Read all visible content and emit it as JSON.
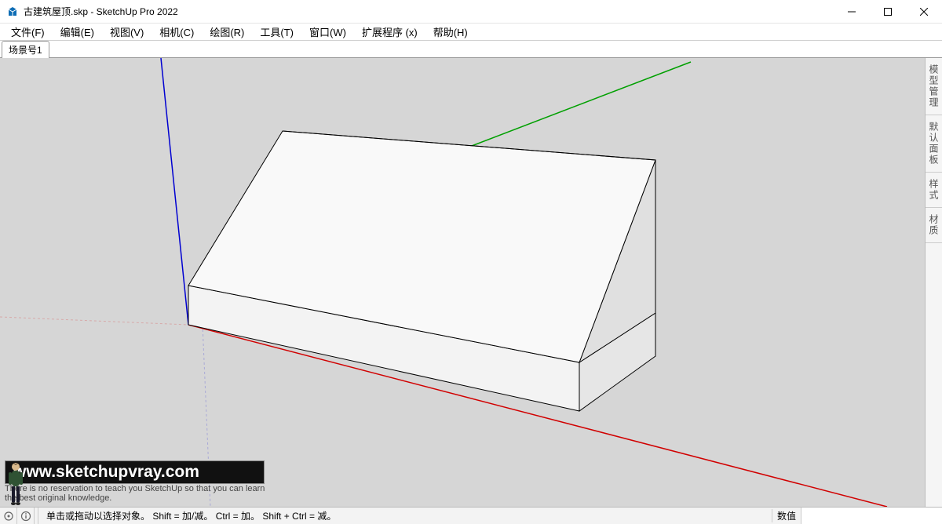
{
  "window": {
    "title": "古建筑屋顶.skp - SketchUp Pro 2022"
  },
  "menu": {
    "items": [
      "文件(F)",
      "编辑(E)",
      "视图(V)",
      "相机(C)",
      "绘图(R)",
      "工具(T)",
      "窗口(W)",
      "扩展程序 (x)",
      "帮助(H)"
    ]
  },
  "scenes": {
    "tabs": [
      "场景号1"
    ]
  },
  "tray": {
    "tabs": [
      "模型管理",
      "默认面板",
      "样式",
      "材质"
    ]
  },
  "status": {
    "hint": "单击或拖动以选择对象。 Shift = 加/减。 Ctrl = 加。 Shift + Ctrl = 减。",
    "measure_label": "数值",
    "measure_value": ""
  },
  "watermark": {
    "url": "www.sketchupvray.com",
    "line1": "There is no reservation to teach you SketchUp so that you can learn",
    "line2": "the best original knowledge."
  },
  "viewport": {
    "axes": {
      "x_color": "#d10000",
      "y_color": "#00a000",
      "z_color": "#0000d1"
    },
    "model_fill_top": "#f9f9f9",
    "model_fill_side": "#ececec",
    "model_fill_side2": "#e0e0e0",
    "bg": "#d6d6d6"
  }
}
